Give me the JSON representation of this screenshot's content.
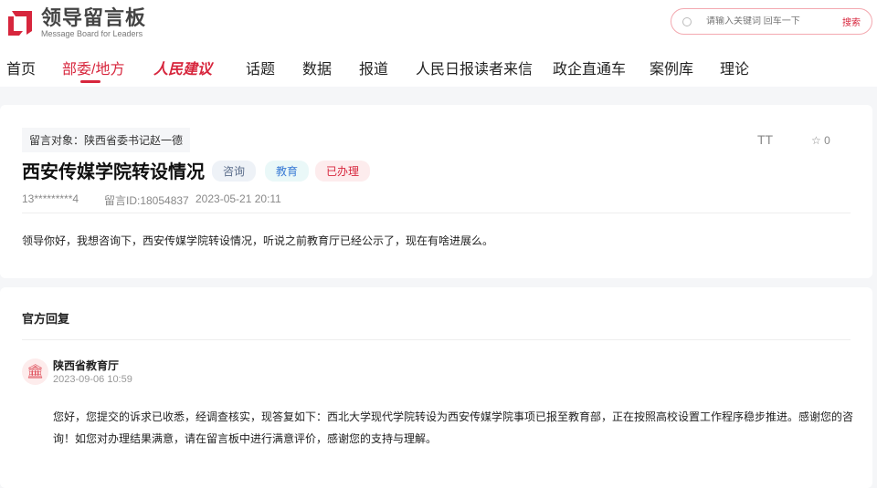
{
  "header": {
    "logo_title": "领导留言板",
    "logo_subtitle": "Message Board for Leaders",
    "search_placeholder": "请输入关键词 回车一下",
    "search_button": "搜索"
  },
  "nav": [
    "首页",
    "部委/地方",
    "人民建议",
    "话题",
    "数据",
    "报道",
    "人民日报读者来信",
    "政企直通车",
    "案例库",
    "理论"
  ],
  "message": {
    "target": "留言对象：陕西省委书记赵一德",
    "title": "西安传媒学院转设情况",
    "tags": [
      "咨询",
      "教育",
      "已办理"
    ],
    "author": "13*********4",
    "id": "留言ID:18054837",
    "time": "2023-05-21 20:11",
    "font_tool": "TT",
    "favorites": "0",
    "content": "领导你好，我想咨询下，西安传媒学院转设情况，听说之前教育厅已经公示了，现在有啥进展么。"
  },
  "reply": {
    "section_title": "官方回复",
    "org": "陕西省教育厅",
    "time": "2023-09-06 10:59",
    "content": "您好，您提交的诉求已收悉，经调查核实，现答复如下：西北大学现代学院转设为西安传媒学院事项已报至教育部，正在按照高校设置工作程序稳步推进。感谢您的咨询！如您对办理结果满意，请在留言板中进行满意评价，感谢您的支持与理解。"
  },
  "colors": {
    "brand": "#d7263d"
  }
}
